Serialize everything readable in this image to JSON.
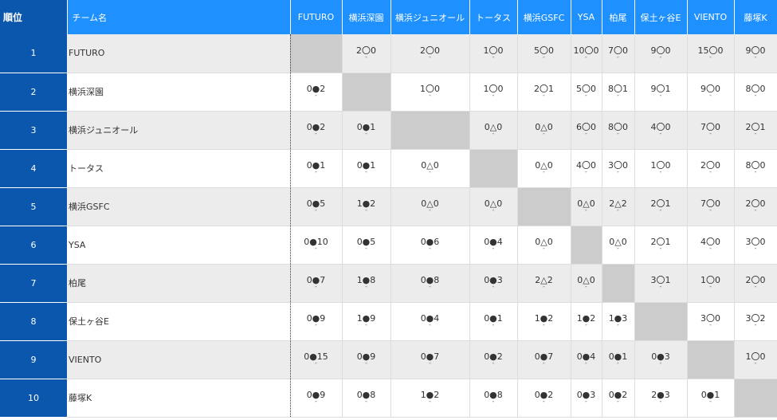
{
  "header": {
    "rank": "順位",
    "team": "チーム名",
    "opponents": [
      "FUTURO",
      "横浜深園",
      "横浜ジュニオール",
      "トータス",
      "横浜GSFC",
      "YSA",
      "柏尾",
      "保土ヶ谷E",
      "VIENTO",
      "藤塚K"
    ]
  },
  "rows": [
    {
      "rank": "1",
      "team": "FUTURO",
      "results": [
        "",
        "2〇0",
        "2〇0",
        "1〇0",
        "5〇0",
        "10〇0",
        "7〇0",
        "9〇0",
        "15〇0",
        "9〇0"
      ]
    },
    {
      "rank": "2",
      "team": "横浜深園",
      "results": [
        "0●2",
        "",
        "1〇0",
        "1〇0",
        "2〇1",
        "5〇0",
        "8〇1",
        "9〇1",
        "9〇0",
        "8〇0"
      ]
    },
    {
      "rank": "3",
      "team": "横浜ジュニオール",
      "results": [
        "0●2",
        "0●1",
        "",
        "0△0",
        "0△0",
        "6〇0",
        "8〇0",
        "4〇0",
        "7〇0",
        "2〇1"
      ]
    },
    {
      "rank": "4",
      "team": "トータス",
      "results": [
        "0●1",
        "0●1",
        "0△0",
        "",
        "0△0",
        "4〇0",
        "3〇0",
        "1〇0",
        "2〇0",
        "8〇0"
      ]
    },
    {
      "rank": "5",
      "team": "横浜GSFC",
      "results": [
        "0●5",
        "1●2",
        "0△0",
        "0△0",
        "",
        "0△0",
        "2△2",
        "2〇1",
        "7〇0",
        "2〇0"
      ]
    },
    {
      "rank": "6",
      "team": "YSA",
      "results": [
        "0●10",
        "0●5",
        "0●6",
        "0●4",
        "0△0",
        "",
        "0△0",
        "2〇1",
        "4〇0",
        "3〇0"
      ]
    },
    {
      "rank": "7",
      "team": "柏尾",
      "results": [
        "0●7",
        "1●8",
        "0●8",
        "0●3",
        "2△2",
        "0△0",
        "",
        "3〇1",
        "1〇0",
        "2〇0"
      ]
    },
    {
      "rank": "8",
      "team": "保土ヶ谷E",
      "results": [
        "0●9",
        "1●9",
        "0●4",
        "0●1",
        "1●2",
        "1●2",
        "1●3",
        "",
        "3〇0",
        "3〇2"
      ]
    },
    {
      "rank": "9",
      "team": "VIENTO",
      "results": [
        "0●15",
        "0●9",
        "0●7",
        "0●2",
        "0●7",
        "0●4",
        "0●1",
        "0●3",
        "",
        "1〇0"
      ]
    },
    {
      "rank": "10",
      "team": "藤塚K",
      "results": [
        "0●9",
        "0●8",
        "1●2",
        "0●8",
        "0●2",
        "0●3",
        "0●2",
        "2●3",
        "0●1",
        ""
      ]
    }
  ],
  "result_mark": "-",
  "colors": {
    "header_bg": "#1e90ff",
    "rank_bg": "#0b57ad",
    "row_alt_bg": "#ececec",
    "self_cell_bg": "#cccccc"
  }
}
